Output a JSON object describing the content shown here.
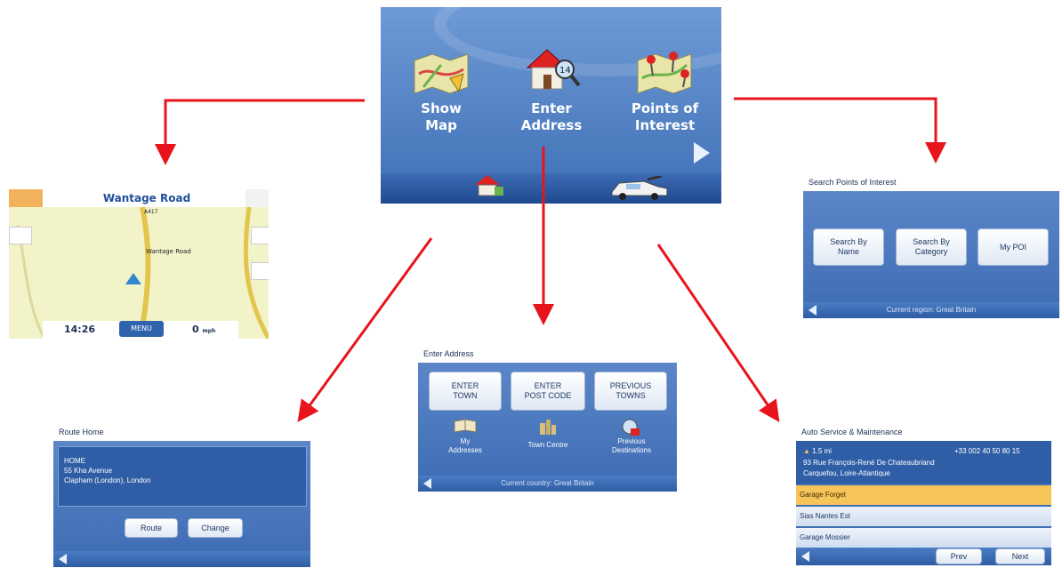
{
  "main_menu": {
    "items": [
      {
        "label": "Show\nMap",
        "icon": "map-icon"
      },
      {
        "label": "Enter\nAddress",
        "icon": "house-icon"
      },
      {
        "label": "Points of\nInterest",
        "icon": "poi-map-icon"
      }
    ],
    "bottom_icons": [
      "home-icon",
      "car-icon"
    ],
    "next_icon": "next-arrow-icon"
  },
  "map_screen": {
    "street": "Wantage Road",
    "road_label_top": "A417",
    "road_label_mid": "Wantage Road",
    "time": "14:26",
    "menu": "MENU",
    "speed": "0",
    "speed_unit": "mph"
  },
  "poi_screen": {
    "title": "Search Points of Interest",
    "buttons": [
      "Search By\nName",
      "Search By\nCategory",
      "My POI"
    ],
    "status": "Current region: Great Britain"
  },
  "address_screen": {
    "title": "Enter Address",
    "buttons": [
      "ENTER\nTOWN",
      "ENTER\nPOST CODE",
      "PREVIOUS\nTOWNS"
    ],
    "icon_items": [
      "My\nAddresses",
      "Town Centre",
      "Previous\nDestinations"
    ],
    "status": "Current country: Great Britain"
  },
  "route_home": {
    "title": "Route Home",
    "address_lines": [
      "HOME",
      "55 Kha Avenue",
      "Clapham (London), London"
    ],
    "route_button": "Route",
    "change_button": "Change"
  },
  "auto_service": {
    "title": "Auto Service & Maintenance",
    "distance": "1.5 mi",
    "phone": "+33 002 40 50 80 15",
    "address_lines": [
      "93 Rue François-René De Chateaubriand",
      "Carquefou, Loire-Atlantique"
    ],
    "list": [
      "Garage Forget",
      "Sias Nantes Est",
      "Garage Mossier"
    ],
    "prev": "Prev",
    "next": "Next"
  },
  "colors": {
    "panel_blue": "#3f6fb5",
    "arrow_red": "#e8141b",
    "highlight": "#f7c45a"
  }
}
